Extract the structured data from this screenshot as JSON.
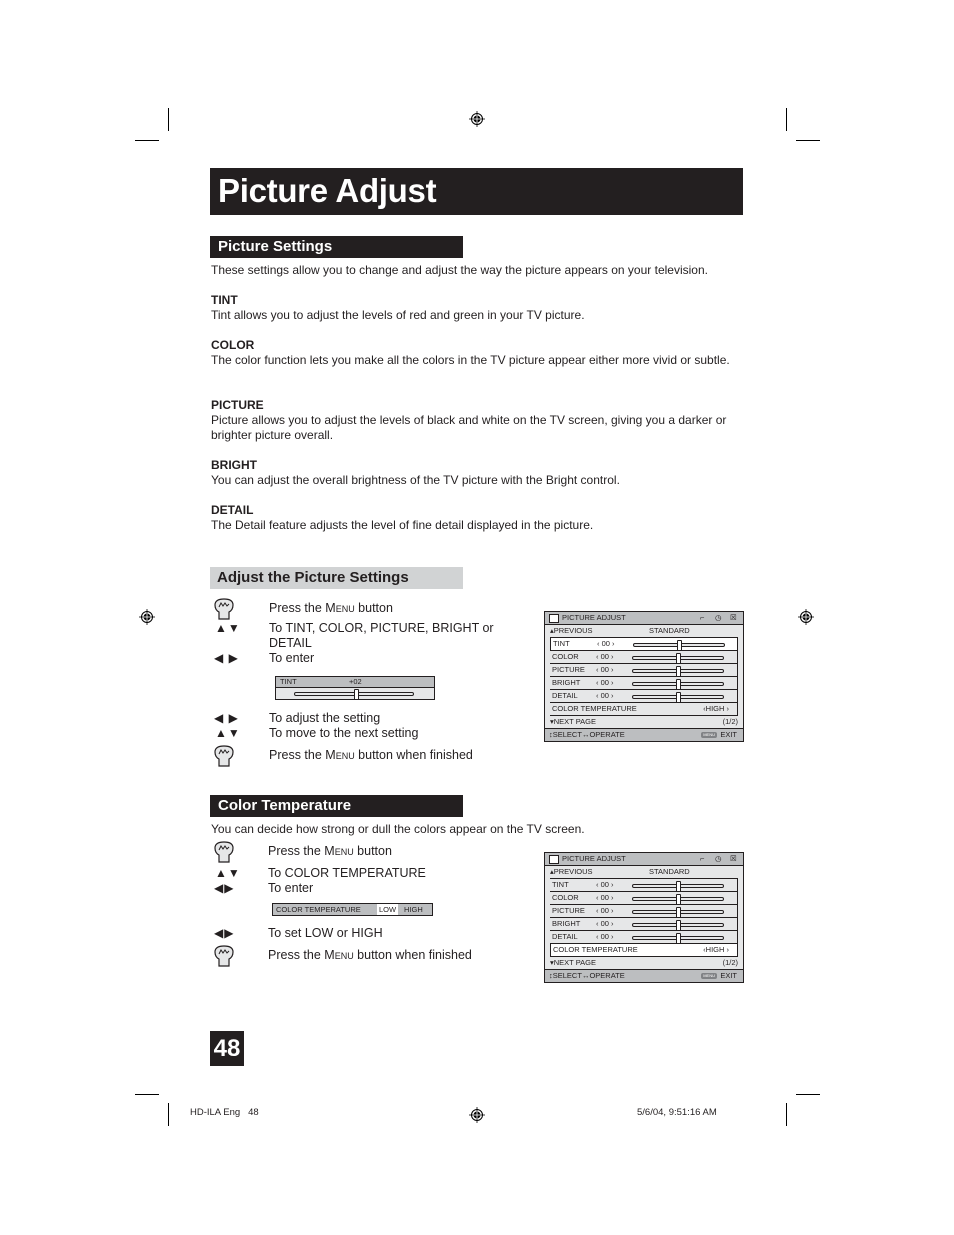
{
  "page": {
    "title": "Picture Adjust",
    "page_number": "48",
    "footer_left": "HD-ILA Eng   48",
    "footer_right": "5/6/04, 9:51:16 AM"
  },
  "picture_settings": {
    "heading": "Picture Settings",
    "intro": "These settings allow you to change and adjust the way the picture appears on your television.",
    "items": [
      {
        "term": "TINT",
        "desc": "Tint allows you to adjust the levels of red and green in your TV picture."
      },
      {
        "term": "COLOR",
        "desc": "The color function lets you make all the colors in the TV picture appear either more vivid or subtle."
      },
      {
        "term": "PICTURE",
        "desc": "Picture allows you to adjust the levels of black and white on the TV screen, giving you a darker or brighter picture overall."
      },
      {
        "term": "BRIGHT",
        "desc": "You can adjust the overall brightness of the TV picture with the Bright control."
      },
      {
        "term": "DETAIL",
        "desc": "The Detail feature adjusts the level of fine detail displayed in the picture."
      }
    ]
  },
  "adjust_section": {
    "heading": "Adjust the Picture Settings",
    "steps": [
      {
        "icon": "hand-press-icon",
        "pre": "Press the ",
        "key": "Menu",
        "post": " button"
      },
      {
        "icon": "up-down-arrows-icon",
        "glyph": "▲▼",
        "text": "To TINT, COLOR, PICTURE, BRIGHT or DETAIL"
      },
      {
        "icon": "left-right-arrows-icon",
        "glyph": "◀ ▶",
        "text": "To enter"
      },
      {
        "icon": "left-right-arrows-icon",
        "glyph": "◀ ▶",
        "text": "To adjust the setting"
      },
      {
        "icon": "up-down-arrows-icon",
        "glyph": "▲▼",
        "text": "To move to the next setting"
      },
      {
        "icon": "hand-press-icon",
        "pre": "Press the ",
        "key": "Menu",
        "post": " button when finished"
      }
    ],
    "tint_bar": {
      "label": "TINT",
      "value": "+02",
      "level_fraction": 0.52
    }
  },
  "color_temp_section": {
    "heading": "Color Temperature",
    "intro": "You can decide how strong or dull the colors appear on the TV screen.",
    "steps": [
      {
        "icon": "hand-press-icon",
        "pre": "Press the ",
        "key": "Menu",
        "post": " button"
      },
      {
        "icon": "up-down-arrows-icon",
        "glyph": "▲▼",
        "text": "To COLOR TEMPERATURE"
      },
      {
        "icon": "left-right-arrows-icon",
        "glyph": "◀▶",
        "text": "To enter"
      },
      {
        "icon": "left-right-arrows-icon",
        "glyph": "◀▶",
        "text": "To set LOW or HIGH"
      },
      {
        "icon": "hand-press-icon",
        "pre": "Press the ",
        "key": "Menu",
        "post": " button when finished"
      }
    ],
    "bar": {
      "label": "COLOR TEMPERATURE",
      "option_low": "LOW",
      "option_high": "HIGH",
      "selected": "LOW"
    }
  },
  "osd_menu": {
    "title": "PICTURE ADJUST",
    "previous": "PREVIOUS",
    "mode": "STANDARD",
    "rows": [
      {
        "label": "TINT",
        "value": "00",
        "level_fraction": 0.5
      },
      {
        "label": "COLOR",
        "value": "00",
        "level_fraction": 0.5
      },
      {
        "label": "PICTURE",
        "value": "00",
        "level_fraction": 0.5
      },
      {
        "label": "BRIGHT",
        "value": "00",
        "level_fraction": 0.5
      },
      {
        "label": "DETAIL",
        "value": "00",
        "level_fraction": 0.5
      }
    ],
    "color_temp_label": "COLOR TEMPERATURE",
    "color_temp_value": "HIGH",
    "next_page": "NEXT PAGE",
    "page_indicator": "(1/2)",
    "footer_select": "SELECT",
    "footer_operate": "OPERATE",
    "footer_menu_key": "MENU",
    "footer_exit": "EXIT"
  }
}
